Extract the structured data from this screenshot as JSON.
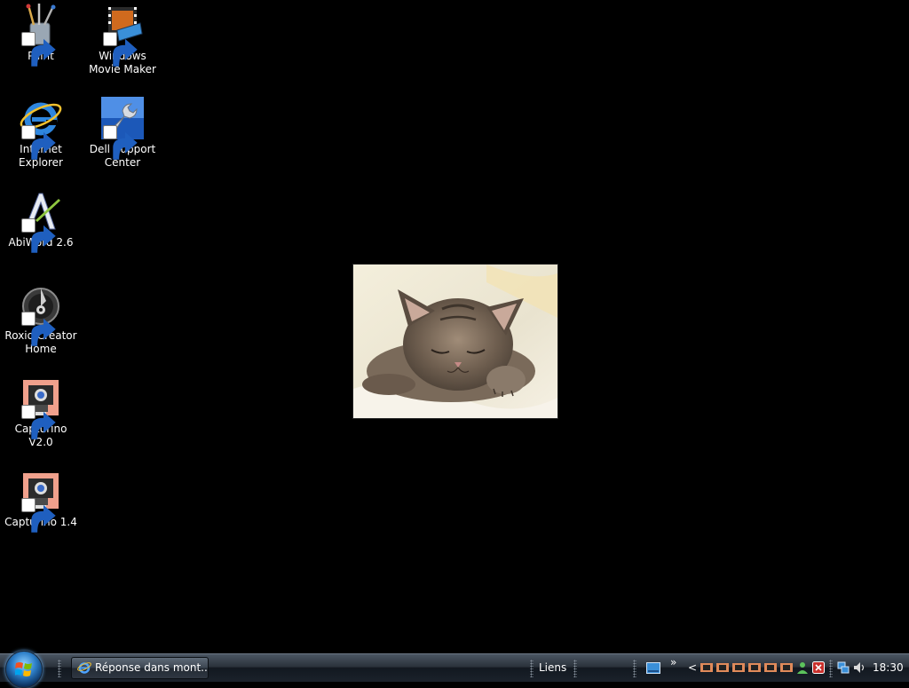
{
  "desktop": {
    "icons": [
      {
        "label": "Paint",
        "icon": "paint-icon"
      },
      {
        "label": "Windows Movie Maker",
        "icon": "movie-maker-icon"
      },
      {
        "label": "Internet Explorer",
        "icon": "internet-explorer-icon"
      },
      {
        "label": "Dell Support Center",
        "icon": "dell-support-icon"
      },
      {
        "label": "AbiWord 2.6",
        "icon": "abiword-icon"
      },
      {
        "label": "Roxio Creator Home",
        "icon": "roxio-icon"
      },
      {
        "label": "Capturino V2.0",
        "icon": "capturino-icon"
      },
      {
        "label": "Capturino 1.4",
        "icon": "capturino-icon"
      }
    ],
    "wallpaper_image": "sleeping-kitten-photo"
  },
  "taskbar": {
    "start_button": "start-orb",
    "task_label": "Réponse dans mont...",
    "links_label": "Liens",
    "chevron": "»",
    "tray_chevron": "<",
    "clock": "18:30"
  },
  "colors": {
    "desktop_background": "#000000",
    "taskbar": "#1b222b",
    "label_text": "#ffffff"
  }
}
